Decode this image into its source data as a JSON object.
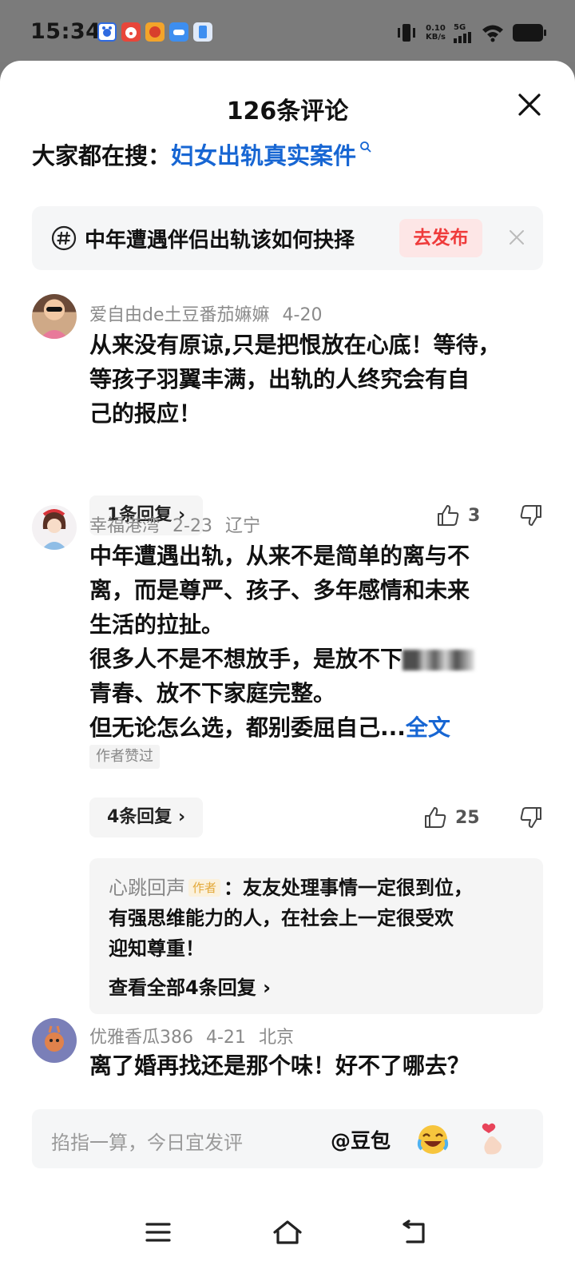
{
  "status_bar": {
    "time": "15:34",
    "net_speed_value": "0.10",
    "net_speed_unit": "KB/s",
    "signal": "5G",
    "app_icons": [
      "baidu-app-icon",
      "clown-app-icon",
      "game-app-icon",
      "game-app-icon-2",
      "blue-app-icon"
    ]
  },
  "header": {
    "title": "126条评论"
  },
  "search": {
    "prefix": "大家都在搜：",
    "query": "妇女出轨真实案件"
  },
  "topic": {
    "text": "中年遭遇伴侣出轨该如何抉择",
    "publish_label": "去发布"
  },
  "comments": [
    {
      "user": "爱自由de土豆番茄嫲嫲",
      "date": "4-20",
      "location": "",
      "lines": [
        "从来没有原谅,只是把恨放在心底！等待，",
        "等孩子羽翼丰满，出轨的人终究会有自",
        "己的报应！"
      ],
      "replies_label": "1条回复",
      "likes": "3"
    },
    {
      "user": "幸福港湾",
      "date": "2-23",
      "location": "辽宁",
      "lines": [
        "中年遭遇出轨，从来不是简单的离与不",
        "离，而是尊严、孩子、多年感情和未来",
        "生活的拉扯。",
        "很多人不是不想放手，是放不下",
        "青春、放不下家庭完整。",
        "但无论怎么选，都别委屈自己..."
      ],
      "more_label": "全文",
      "author_liked": "作者赞过",
      "replies_label": "4条回复",
      "likes": "25",
      "reply_preview": {
        "author": "心跳回声",
        "tag": "作者",
        "lines": [
          "：友友处理事情一定很到位，",
          "有强思维能力的人，在社会上一定很受欢",
          "迎知尊重！"
        ],
        "view_all": "查看全部4条回复"
      }
    },
    {
      "user": "优雅香瓜386",
      "date": "4-21",
      "location": "北京",
      "lines": [
        "离了婚再找还是那个味！好不了哪去？"
      ]
    }
  ],
  "input_bar": {
    "placeholder": "掐指一算，今日宜发评",
    "mention": "@豆包"
  },
  "colors": {
    "link_blue": "#1766d3",
    "publish_red": "#ef3b3b",
    "publish_bg": "#fde6e6"
  }
}
